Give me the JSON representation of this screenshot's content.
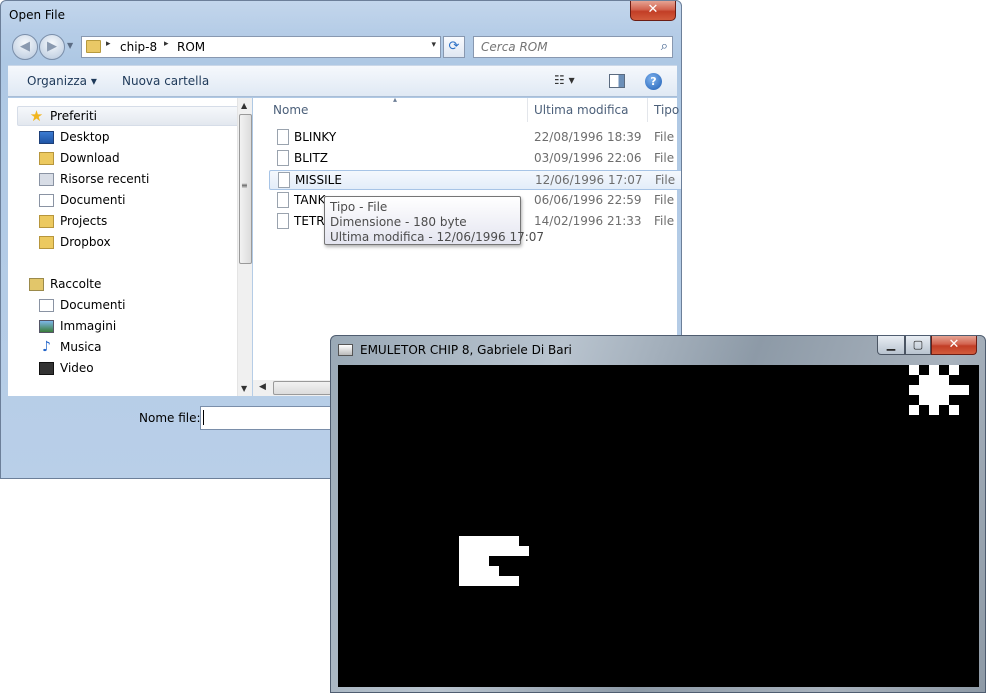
{
  "open_dialog": {
    "title": "Open File",
    "close_glyph": "✕",
    "address": {
      "crumbs": [
        "chip-8",
        "ROM"
      ],
      "separator": "▸",
      "dropdown": "▾"
    },
    "search": {
      "placeholder": "Cerca ROM"
    },
    "toolbar": {
      "organize": "Organizza ▾",
      "new_folder": "Nuova cartella",
      "view_menu": "☷ ▾",
      "help": "?"
    },
    "nav": {
      "favorites_header": "Preferiti",
      "favorites": [
        "Desktop",
        "Download",
        "Risorse recenti",
        "Documenti",
        "Projects",
        "Dropbox"
      ],
      "libraries_header": "Raccolte",
      "libraries": [
        "Documenti",
        "Immagini",
        "Musica",
        "Video"
      ]
    },
    "columns": {
      "name": "Nome",
      "modified": "Ultima modifica",
      "type": "Tipo"
    },
    "files": [
      {
        "name": "BLINKY",
        "date": "22/08/1996 18:39",
        "type": "File"
      },
      {
        "name": "BLITZ",
        "date": "03/09/1996 22:06",
        "type": "File"
      },
      {
        "name": "MISSILE",
        "date": "12/06/1996 17:07",
        "type": "File"
      },
      {
        "name": "TANK",
        "date": "06/06/1996 22:59",
        "type": "File"
      },
      {
        "name": "TETRIS",
        "date": "14/02/1996 21:33",
        "type": "File"
      }
    ],
    "tooltip": [
      "Tipo - File",
      "Dimensione - 180 byte",
      "Ultima modifica - 12/06/1996 17:07"
    ],
    "filename_label": "Nome file:",
    "filename_value": ""
  },
  "emulator": {
    "title": "EMULETOR CHIP 8, Gabriele Di Bari",
    "buttons": {
      "minimize": "▁",
      "maximize": "▢",
      "close": "✕"
    },
    "screen_bg": "#000000",
    "pixel_color": "#ffffff"
  }
}
